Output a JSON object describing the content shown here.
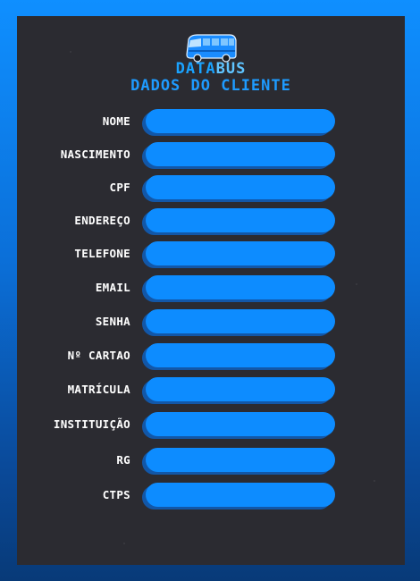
{
  "header": {
    "brand_part1": "DATA",
    "brand_part2": "BUS",
    "subtitle": "DADOS DO CLIENTE",
    "logo_icon": "bus-icon"
  },
  "form": {
    "fields": [
      {
        "label": "NOME",
        "value": ""
      },
      {
        "label": "NASCIMENTO",
        "value": ""
      },
      {
        "label": "CPF",
        "value": ""
      },
      {
        "label": "ENDEREÇO",
        "value": ""
      },
      {
        "label": "TELEFONE",
        "value": ""
      },
      {
        "label": "EMAIL",
        "value": ""
      },
      {
        "label": "SENHA",
        "value": ""
      },
      {
        "label": "Nº CARTAO",
        "value": ""
      },
      {
        "label": "MATRÍCULA",
        "value": ""
      },
      {
        "label": "INSTITUIÇÃO",
        "value": ""
      },
      {
        "label": "RG",
        "value": ""
      },
      {
        "label": "CTPS",
        "value": ""
      }
    ]
  },
  "colors": {
    "background_top": "#0f8fff",
    "background_bottom": "#083a78",
    "panel": "#2b2b31",
    "field": "#0d8cff",
    "field_shadow": "#1257a8",
    "accent": "#1e9bff"
  }
}
